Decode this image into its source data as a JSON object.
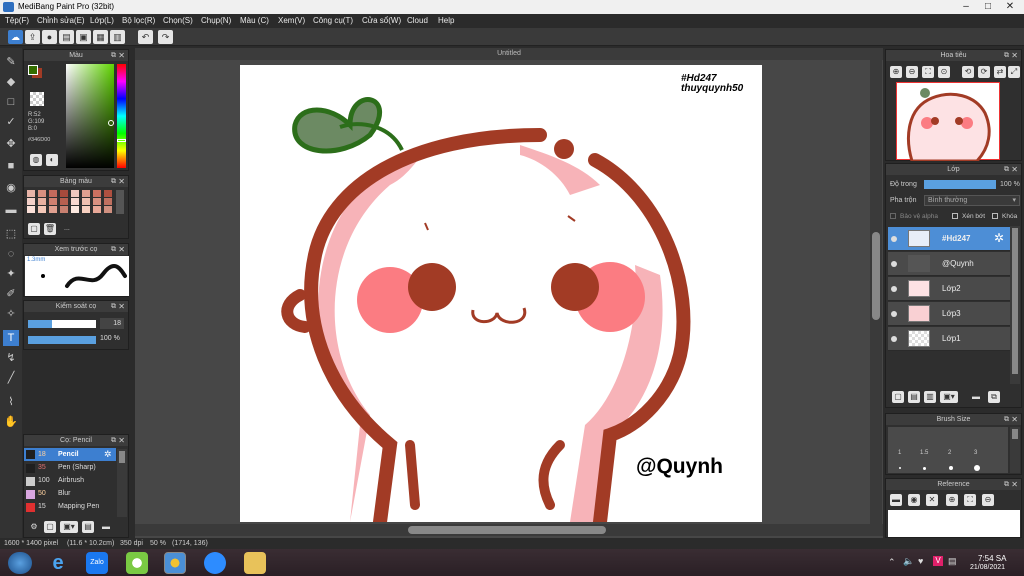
{
  "window": {
    "title": "MediBang Paint Pro (32bit)"
  },
  "menu": [
    "Tệp(F)",
    "Chỉnh sửa(E)",
    "Lớp(L)",
    "Bộ lọc(R)",
    "Chọn(S)",
    "Chụp(N)",
    "Màu (C)",
    "Xem(V)",
    "Công cụ(T)",
    "Cửa sổ(W)",
    "Cloud",
    "Help"
  ],
  "document": {
    "tab": "Untitled"
  },
  "color_panel": {
    "title": "Màu",
    "rgb": [
      "R:52",
      "G:109",
      "B:0"
    ],
    "hex": "#346D00",
    "main_color": "#346d00",
    "sub_color": "#a23b25"
  },
  "palette_panel": {
    "title": "Bảng màu",
    "extra": "..."
  },
  "brush_preview_panel": {
    "title": "Xem trước cọ",
    "size": "1.3mm"
  },
  "brush_control_panel": {
    "title": "Kiểm soát cọ",
    "size_value": "18",
    "opacity_value": "100 %",
    "opacity": 1.0
  },
  "brush_panel": {
    "title": "Cọ: Pencil",
    "items": [
      {
        "size": "18",
        "name": "Pencil",
        "selected": true
      },
      {
        "size": "35",
        "name": "Pen (Sharp)"
      },
      {
        "size": "100",
        "name": "Airbrush"
      },
      {
        "size": "50",
        "name": "Blur"
      },
      {
        "size": "15",
        "name": "Mapping Pen"
      }
    ]
  },
  "navigator_panel": {
    "title": "Hoa tiêu"
  },
  "layer_panel": {
    "title": "Lớp",
    "opacity_label": "Độ trong",
    "opacity_value": "100 %",
    "opacity": 1.0,
    "blend_label": "Pha trộn",
    "blend_value": "Bình thường",
    "protect_alpha": "Bảo vệ alpha",
    "clipping": "Xén bớt",
    "lock": "Khóa",
    "layers": [
      {
        "name": "#Hd247",
        "selected": true
      },
      {
        "name": "@Quynh"
      },
      {
        "name": "Lớp2"
      },
      {
        "name": "Lớp3"
      },
      {
        "name": "Lớp1"
      }
    ]
  },
  "brush_size_panel": {
    "title": "Brush Size",
    "sizes": [
      "1",
      "1.5",
      "2",
      "3"
    ]
  },
  "reference_panel": {
    "title": "Reference"
  },
  "canvas_text": {
    "tag": "#Hd247",
    "author": "thuyquynh50",
    "signature": "@Quynh"
  },
  "status": {
    "size": "1600 * 1400 pixel",
    "cm": "(11.6 * 10.2cm)",
    "dpi": "350 dpi",
    "zoom": "50 %",
    "coords": "(1714, 136)"
  },
  "taskbar": {
    "time": "7:54 SA",
    "date": "21/08/2021",
    "zalo_label": "Zalo"
  }
}
